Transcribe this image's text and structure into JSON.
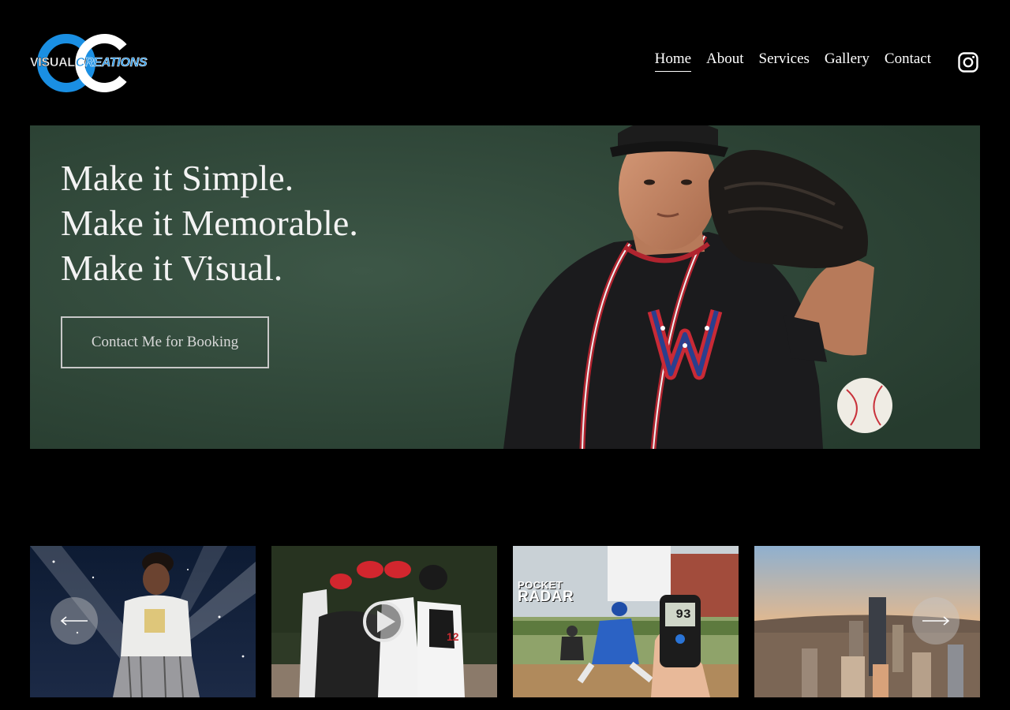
{
  "header": {
    "logo": {
      "word1": "VISUAL",
      "word2": "CREATIONS"
    },
    "nav": [
      {
        "label": "Home",
        "active": true
      },
      {
        "label": "About",
        "active": false
      },
      {
        "label": "Services",
        "active": false
      },
      {
        "label": "Gallery",
        "active": false
      },
      {
        "label": "Contact",
        "active": false
      }
    ],
    "social_icon": "instagram-icon"
  },
  "hero": {
    "lines": [
      "Make it Simple.",
      "Make it Memorable.",
      "Make it Visual."
    ],
    "cta_label": "Contact Me for Booking"
  },
  "gallery": {
    "items": [
      {
        "name": "concert-performer-photo"
      },
      {
        "name": "baseball-mound-video",
        "has_play_icon": true
      },
      {
        "name": "pocket-radar-photo",
        "caption_top": "POCKET",
        "caption_bottom": "RADAR",
        "reading": "93"
      },
      {
        "name": "city-skyline-photo"
      }
    ],
    "prev_icon": "arrow-left-icon",
    "next_icon": "arrow-right-icon"
  },
  "colors": {
    "background": "#000000",
    "text": "#ffffff",
    "brand_blue": "#1a8fe3",
    "hero_green": "#2f4638"
  }
}
